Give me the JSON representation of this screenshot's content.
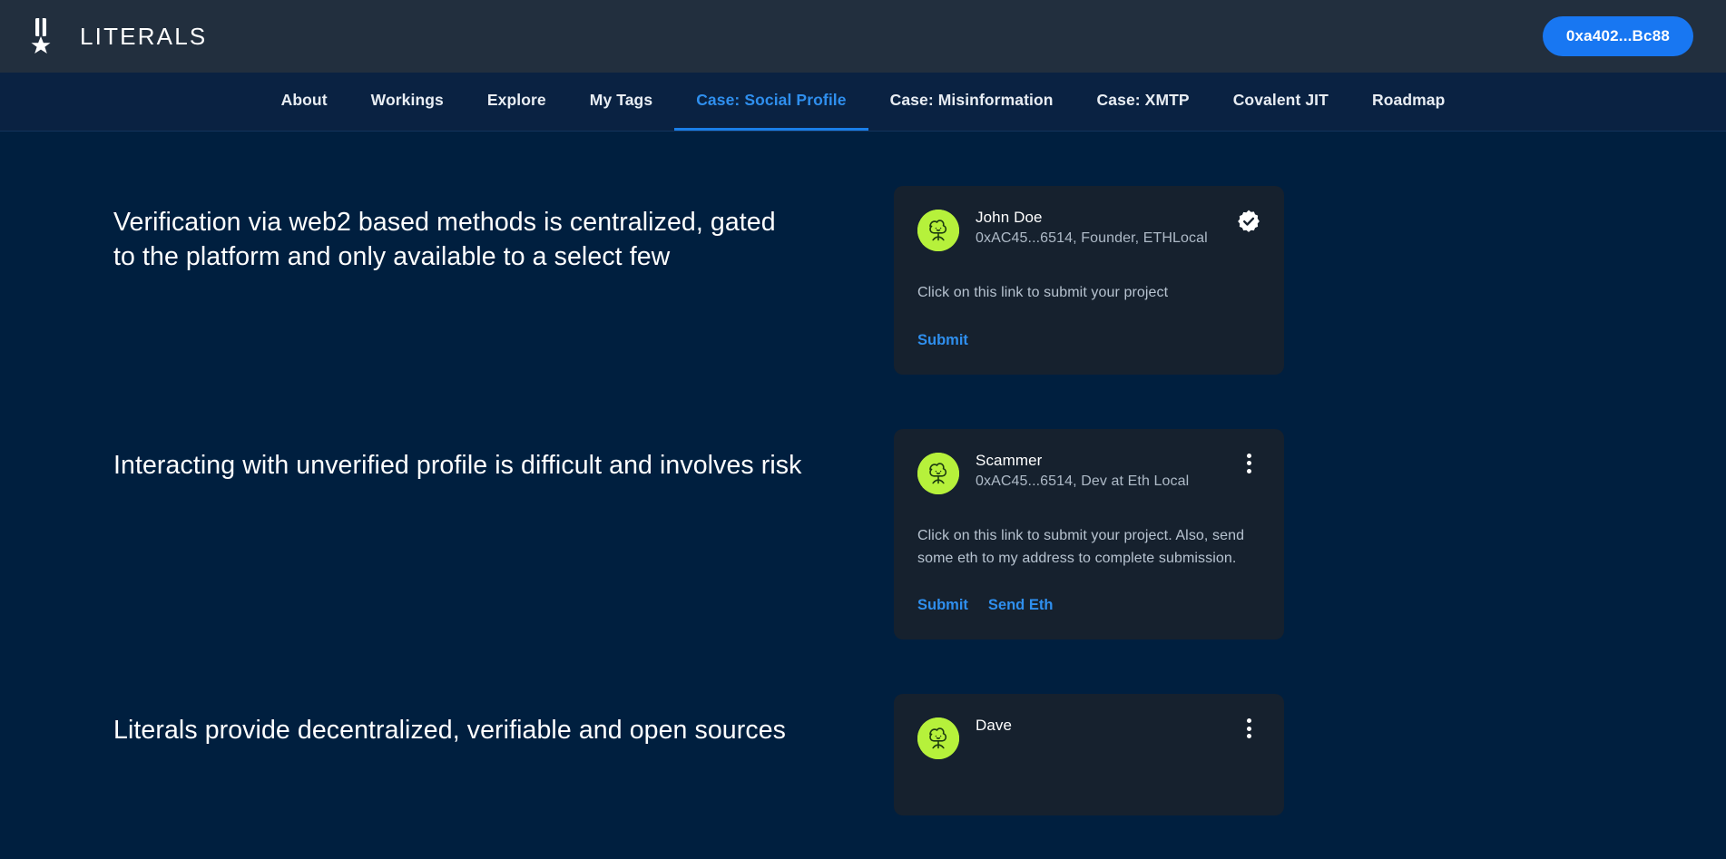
{
  "header": {
    "logo_icon": "medal-icon",
    "brand_title": "LITERALS",
    "wallet_label": "0xa402...Bc88",
    "accent_color": "#1877f2",
    "background_color": "#222f3e"
  },
  "nav": {
    "items": [
      {
        "label": "About",
        "active": false
      },
      {
        "label": "Workings",
        "active": false
      },
      {
        "label": "Explore",
        "active": false
      },
      {
        "label": "My Tags",
        "active": false
      },
      {
        "label": "Case: Social Profile",
        "active": true
      },
      {
        "label": "Case: Misinformation",
        "active": false
      },
      {
        "label": "Case: XMTP",
        "active": false
      },
      {
        "label": "Covalent JIT",
        "active": false
      },
      {
        "label": "Roadmap",
        "active": false
      }
    ],
    "active_color": "#2f8fee",
    "underline_color": "#1a7fe8"
  },
  "page": {
    "background_color": "#001f3f",
    "card_background_color": "#16212e",
    "avatar_color": "#b6f13b"
  },
  "sections": [
    {
      "heading": "Verification via web2 based methods is centralized, gated to the platform and only available to a select few",
      "card": {
        "avatar_icon": "mushroom-avatar-icon",
        "name": "John Doe",
        "meta": "0xAC45...6514, Founder, ETHLocal",
        "badge_icon": "verified-badge-icon",
        "body": "Click on this link to submit your project",
        "actions": [
          {
            "label": "Submit"
          }
        ]
      }
    },
    {
      "heading": "Interacting with unverified profile is difficult and involves risk",
      "card": {
        "avatar_icon": "mushroom-avatar-icon",
        "name": "Scammer",
        "meta": "0xAC45...6514, Dev at Eth Local",
        "badge_icon": "more-vertical-icon",
        "body": "Click on this link to submit your project. Also, send some eth to my address to complete submission.",
        "actions": [
          {
            "label": "Submit"
          },
          {
            "label": "Send Eth"
          }
        ]
      }
    },
    {
      "heading": "Literals provide decentralized, verifiable and open sources",
      "card": {
        "avatar_icon": "mushroom-avatar-icon",
        "name": "Dave",
        "meta": "",
        "badge_icon": "more-vertical-icon",
        "body": "",
        "actions": []
      }
    }
  ]
}
